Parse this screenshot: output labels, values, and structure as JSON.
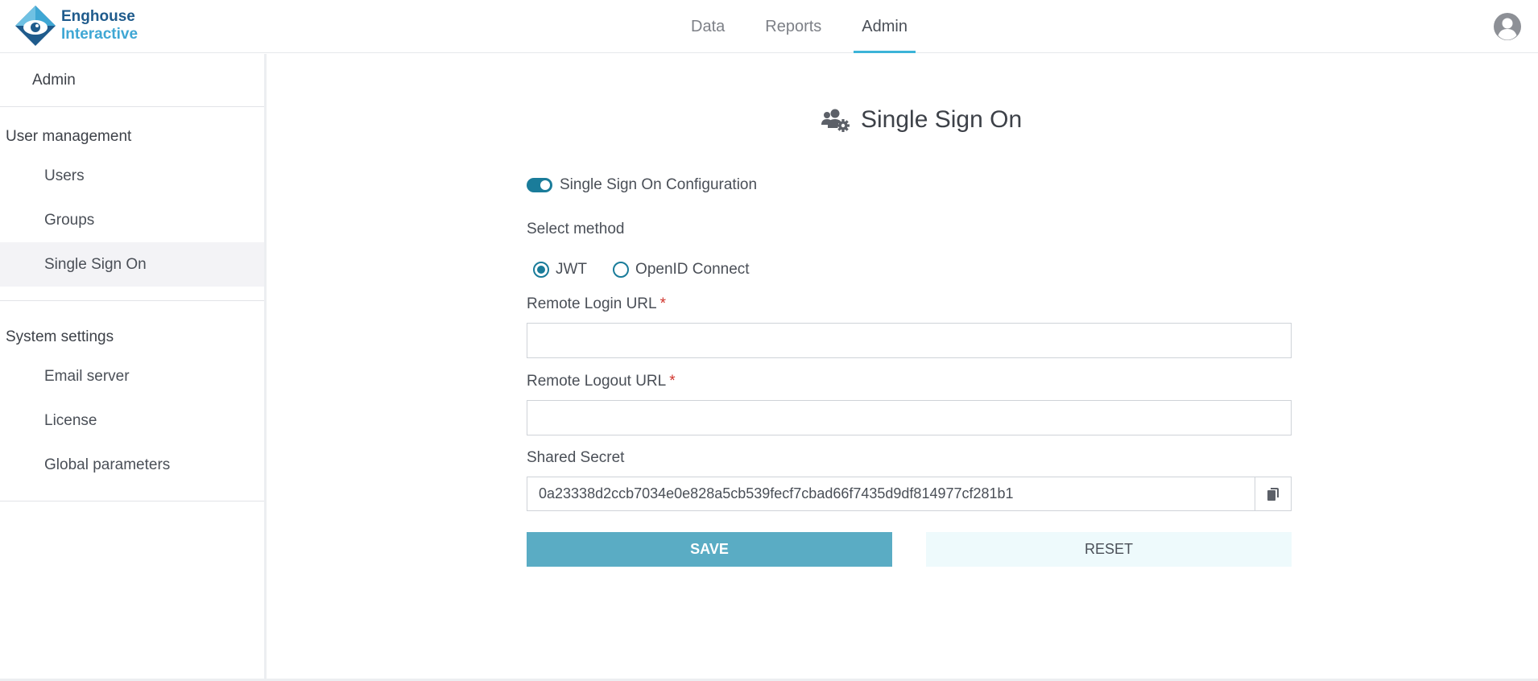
{
  "brand": {
    "line1": "Enghouse",
    "line2": "Interactive",
    "colors": {
      "dark": "#1f5b8c",
      "light": "#3fa7d4"
    }
  },
  "nav": {
    "tabs": [
      {
        "label": "Data",
        "active": false
      },
      {
        "label": "Reports",
        "active": false
      },
      {
        "label": "Admin",
        "active": true
      }
    ],
    "accent": "#3cb4d8",
    "user_icon": "user-circle-icon"
  },
  "sidebar": {
    "title": "Admin",
    "sections": [
      {
        "heading": "User management",
        "items": [
          "Users",
          "Groups",
          "Single Sign On"
        ],
        "active": "Single Sign On"
      },
      {
        "heading": "System settings",
        "items": [
          "Email server",
          "License",
          "Global parameters"
        ]
      }
    ]
  },
  "page": {
    "title": "Single Sign On",
    "title_icon": "users-gear-icon",
    "toggle": {
      "label": "Single Sign On Configuration",
      "on": true
    },
    "select_method": {
      "label": "Select method",
      "options": [
        "JWT",
        "OpenID Connect"
      ],
      "selected": "JWT"
    },
    "remote_login": {
      "label": "Remote Login URL",
      "required_mark": "*",
      "value": ""
    },
    "remote_logout": {
      "label": "Remote Logout URL",
      "required_mark": "*",
      "value": ""
    },
    "shared_secret": {
      "label": "Shared Secret",
      "value": "0a23338d2ccb7034e0e828a5cb539fecf7cbad66f7435d9df814977cf281b1",
      "copy_icon": "copy-icon"
    },
    "buttons": {
      "save": "SAVE",
      "reset": "RESET"
    },
    "colors": {
      "primary": "#1a7c9a",
      "save_bg": "#5aacc4",
      "reset_bg": "#eefafc",
      "required": "#d0342c"
    }
  }
}
